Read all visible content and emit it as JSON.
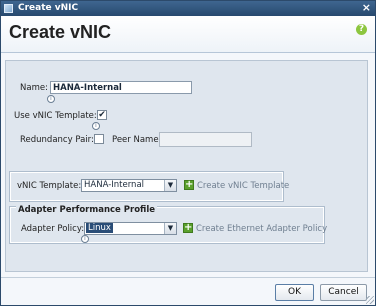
{
  "window": {
    "title": "Create vNIC",
    "close_glyph": "×"
  },
  "header": {
    "title": "Create vNIC",
    "help_icon": "?"
  },
  "form": {
    "name_label": "Name:",
    "name_value": "HANA-Internal",
    "use_template_label": "Use vNIC Template:",
    "use_template_checked": true,
    "check_glyph": "✔",
    "redundancy_label": "Redundancy Pair:",
    "redundancy_checked": false,
    "peer_name_label": "Peer Name:",
    "peer_name_value": "",
    "vnic_template_label": "vNIC Template:",
    "vnic_template_value": "HANA-Internal",
    "create_template_link": "Create vNIC Template",
    "adapter_group_title": "Adapter Performance Profile",
    "adapter_policy_label": "Adapter Policy:",
    "adapter_policy_value": "Linux",
    "create_adapter_policy_link": "Create Ethernet Adapter Policy",
    "info_glyph": "i",
    "dropdown_arrow": "▼",
    "plus_glyph": "+"
  },
  "buttons": {
    "ok": "OK",
    "cancel": "Cancel"
  },
  "colors": {
    "titlebar": "#27496e",
    "content_bg": "#dfe6ee",
    "link_disabled": "#6f7f90",
    "plus_green": "#5aa02c",
    "selection": "#2a4d77"
  }
}
